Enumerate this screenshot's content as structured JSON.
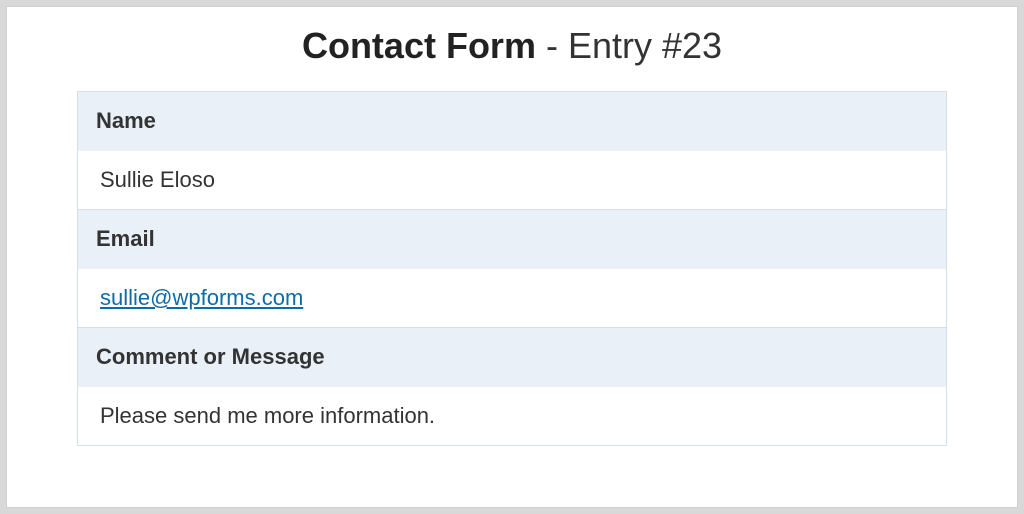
{
  "header": {
    "form_name": "Contact Form",
    "entry_suffix": " - Entry #23"
  },
  "fields": [
    {
      "label": "Name",
      "value": "Sullie Eloso",
      "type": "text"
    },
    {
      "label": "Email",
      "value": "sullie@wpforms.com",
      "type": "email"
    },
    {
      "label": "Comment or Message",
      "value": "Please send me more information.",
      "type": "text"
    }
  ]
}
